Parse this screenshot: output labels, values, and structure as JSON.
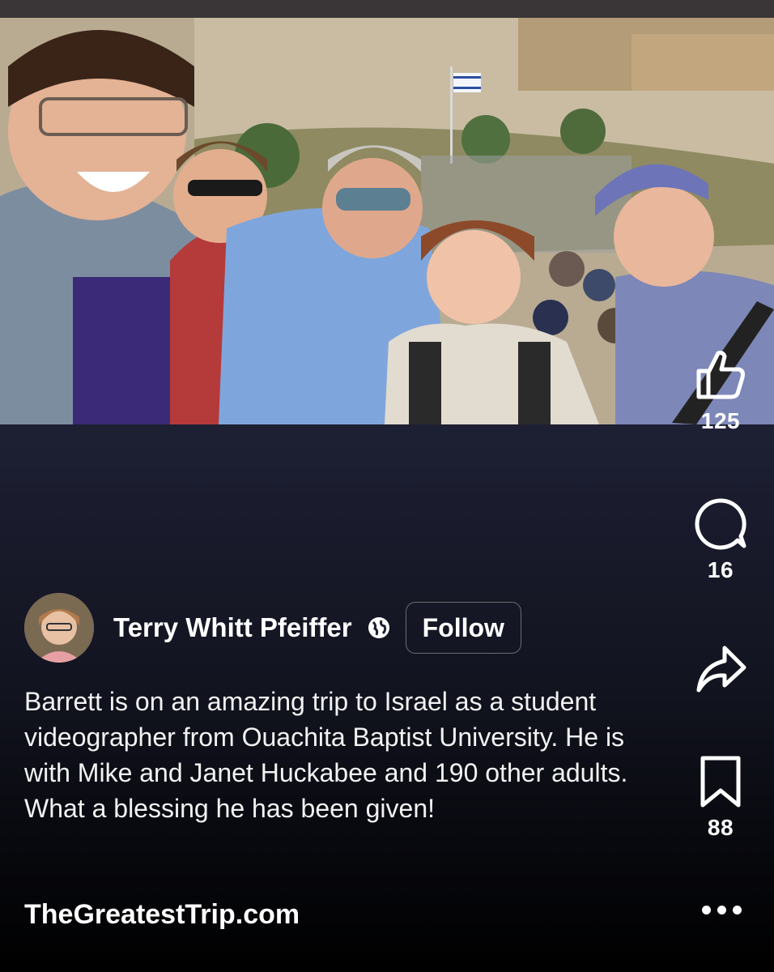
{
  "post": {
    "author": {
      "name": "Terry Whitt Pfeiffer",
      "follow_label": "Follow"
    },
    "caption": "Barrett is on an amazing trip to Israel as a student videographer from Ouachita Baptist University. He is with Mike and Janet Huckabee and 190 other adults.  What a blessing he has been given!",
    "link_text": "TheGreatestTrip.com"
  },
  "actions": {
    "like_count": "125",
    "comment_count": "16",
    "save_count": "88"
  },
  "icons": [
    "thumbs-up-icon",
    "comment-icon",
    "share-icon",
    "bookmark-icon",
    "globe-icon",
    "more-icon"
  ],
  "colors": {
    "background_top": "#2b2226",
    "background_bottom": "#000000",
    "text": "#ffffff",
    "follow_border": "#6b6b73"
  }
}
